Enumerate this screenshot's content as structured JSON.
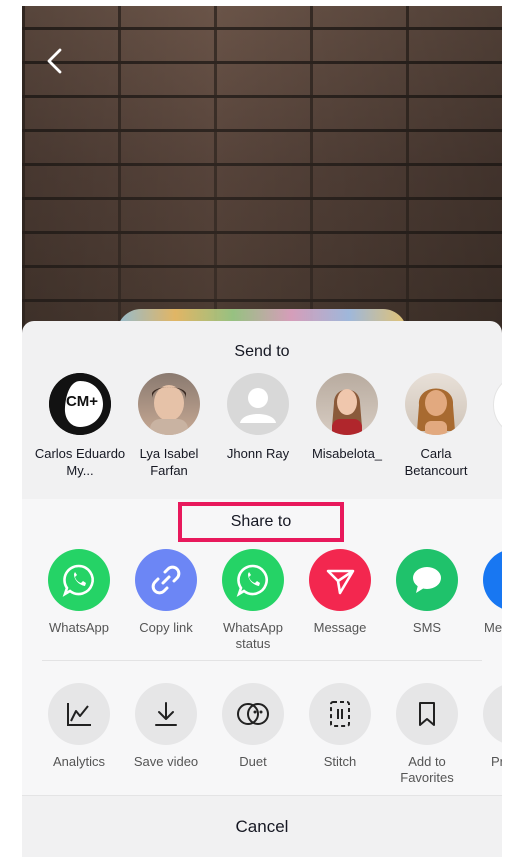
{
  "send_to": {
    "title": "Send to",
    "contacts": [
      {
        "name": "Carlos Eduardo My...",
        "avatar_text": "CM+"
      },
      {
        "name": "Lya Isabel Farfan"
      },
      {
        "name": "Jhonn Ray"
      },
      {
        "name": "Misabelota_"
      },
      {
        "name": "Carla Betancourt"
      }
    ]
  },
  "share_to": {
    "title": "Share to",
    "apps": [
      {
        "label": "WhatsApp",
        "icon": "whatsapp-icon",
        "color": "#25d366"
      },
      {
        "label": "Copy link",
        "icon": "link-icon",
        "color": "#6c86f5"
      },
      {
        "label": "WhatsApp status",
        "icon": "whatsapp-icon",
        "color": "#25d366"
      },
      {
        "label": "Message",
        "icon": "send-icon",
        "color": "#f3274f"
      },
      {
        "label": "SMS",
        "icon": "chat-bubble-icon",
        "color": "#1fc26b"
      },
      {
        "label": "Mes",
        "icon": "messenger-icon",
        "color": "#1877f2"
      }
    ]
  },
  "actions": [
    {
      "label": "Analytics",
      "icon": "analytics-icon"
    },
    {
      "label": "Save video",
      "icon": "download-icon"
    },
    {
      "label": "Duet",
      "icon": "duet-icon"
    },
    {
      "label": "Stitch",
      "icon": "stitch-icon"
    },
    {
      "label": "Add to Favorites",
      "icon": "bookmark-icon"
    },
    {
      "label": "Pr se",
      "icon": "more-icon"
    }
  ],
  "cancel_label": "Cancel"
}
